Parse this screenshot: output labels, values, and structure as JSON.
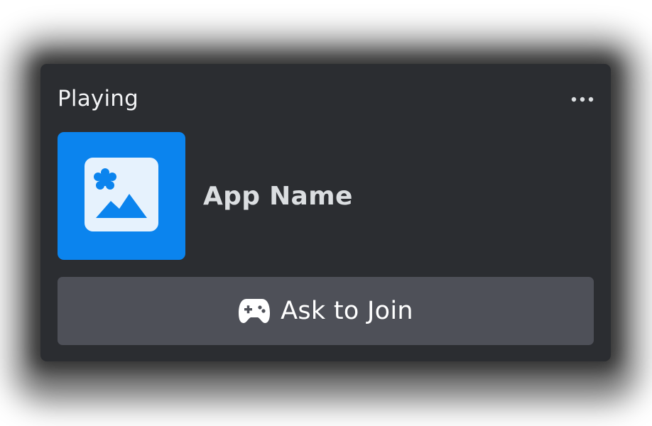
{
  "activity": {
    "header_title": "Playing",
    "app_name": "App Name",
    "join_label": "Ask to Join"
  },
  "icons": {
    "more": "more-options-icon",
    "app_placeholder": "image-placeholder-icon",
    "join": "gamepad-icon"
  },
  "colors": {
    "card_background": "#2b2d31",
    "thumb_background": "#0b84ee",
    "button_background": "#4e5058",
    "primary_text": "#f2f3f5",
    "secondary_text": "#dbdee1"
  }
}
